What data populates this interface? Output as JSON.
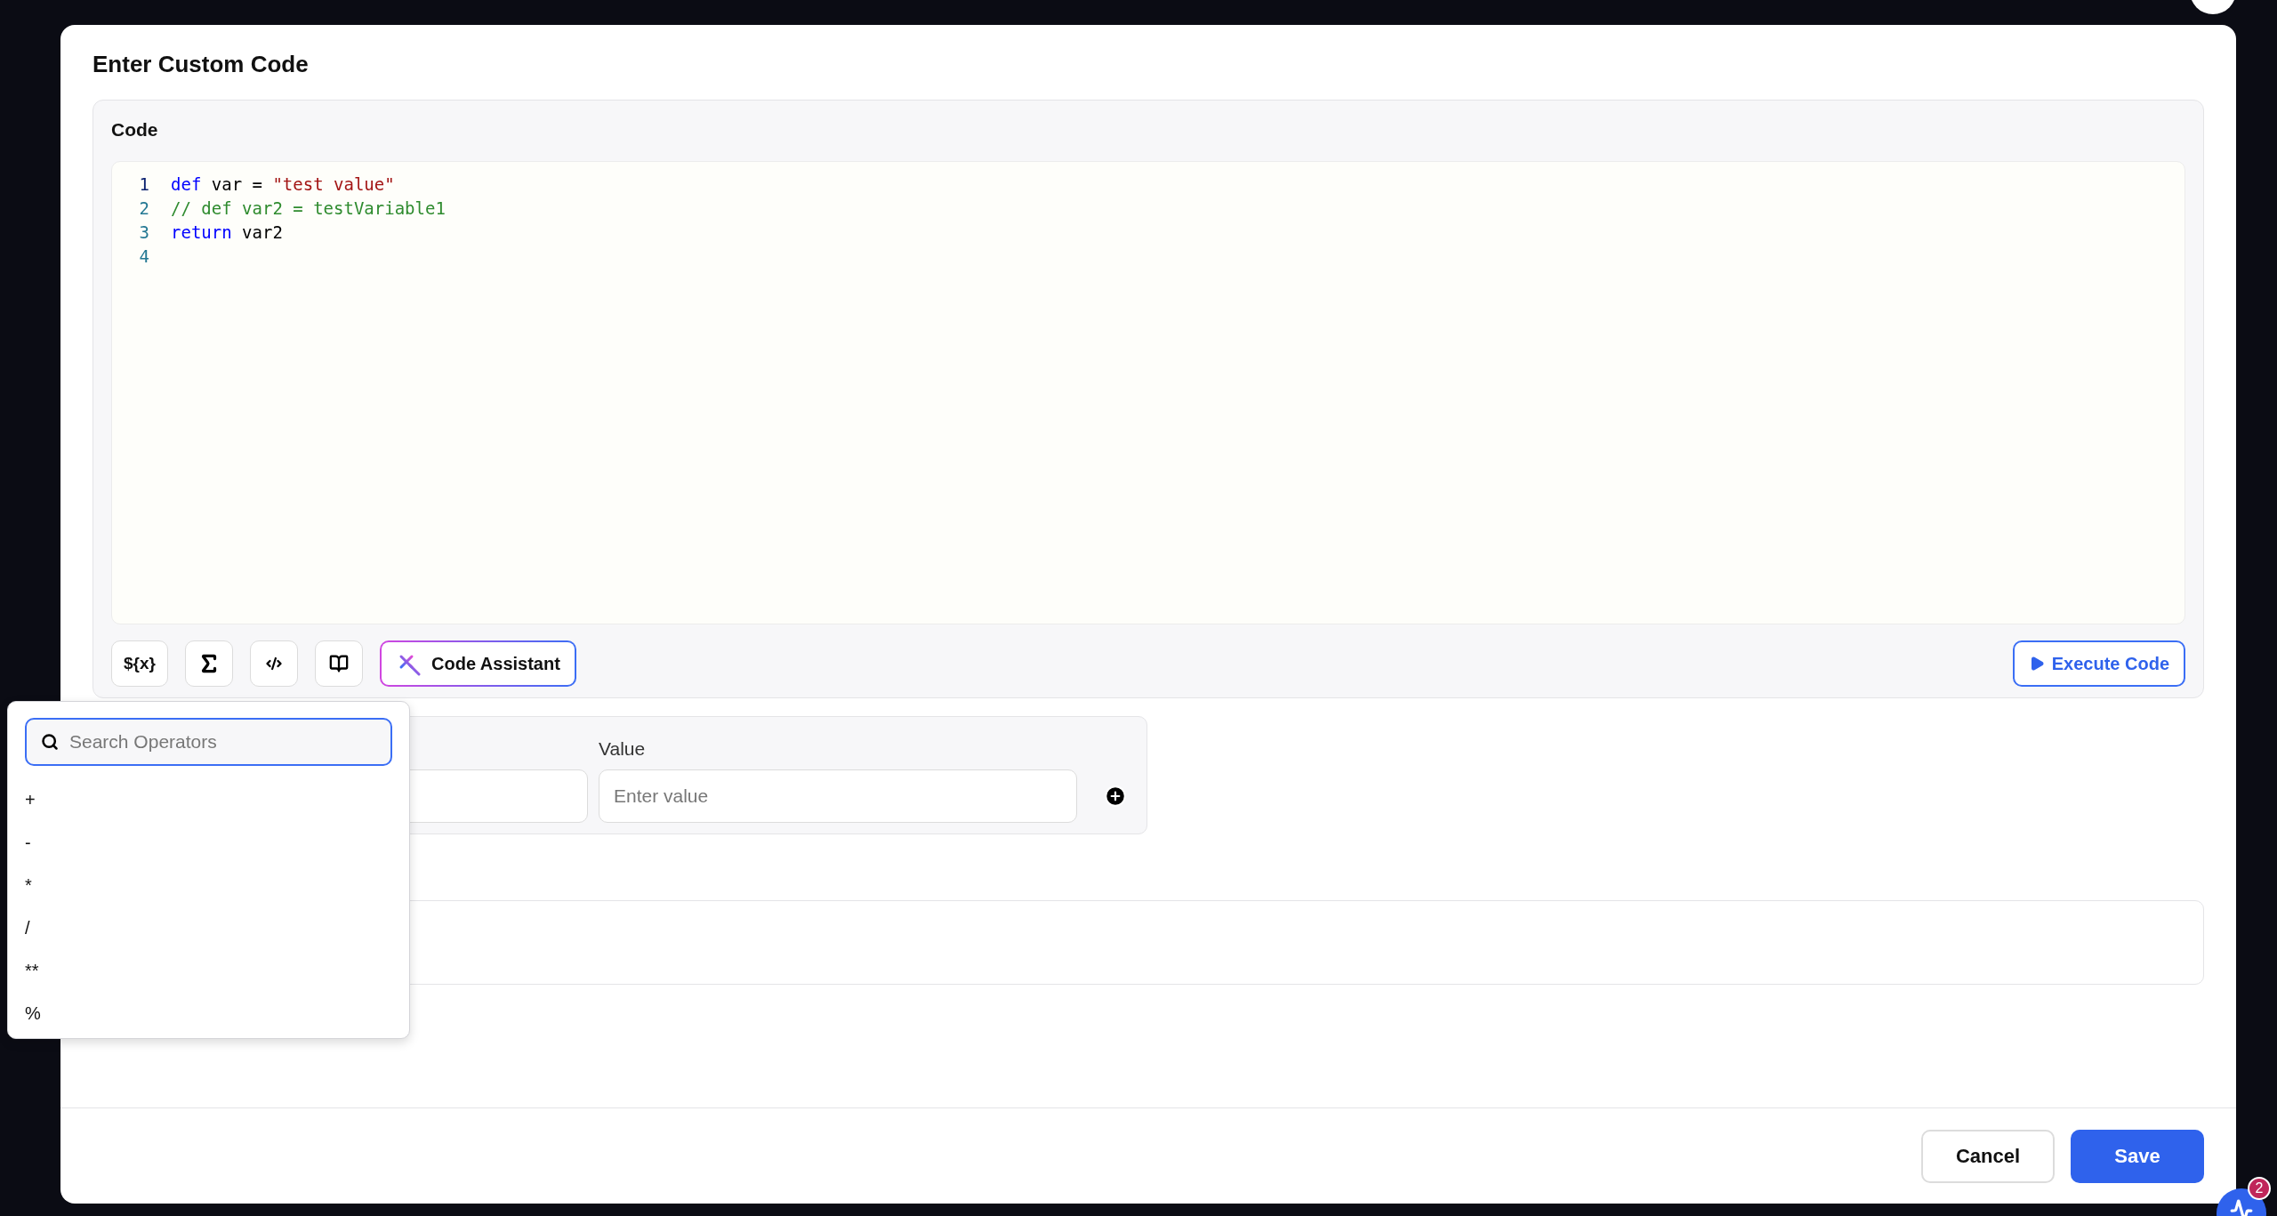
{
  "dialog": {
    "title": "Enter Custom Code"
  },
  "code_panel": {
    "label": "Code",
    "lines": [
      {
        "number": "1",
        "active": true,
        "tokens": [
          {
            "kind": "keyword",
            "text": "def"
          },
          {
            "kind": "plain",
            "text": " var = "
          },
          {
            "kind": "string",
            "text": "\"test value\""
          }
        ]
      },
      {
        "number": "2",
        "active": false,
        "tokens": [
          {
            "kind": "comment",
            "text": "// def var2 = testVariable1"
          }
        ]
      },
      {
        "number": "3",
        "active": false,
        "tokens": [
          {
            "kind": "keyword",
            "text": "return"
          },
          {
            "kind": "plain",
            "text": " var2"
          }
        ]
      },
      {
        "number": "4",
        "active": false
      }
    ],
    "variable_button": "${x}",
    "assistant_button": "Code Assistant",
    "execute_button": "Execute Code"
  },
  "parameters": {
    "value_label": "Value",
    "value_placeholder": "Enter value"
  },
  "operator_menu": {
    "search_placeholder": "Search Operators",
    "items": [
      "+",
      "-",
      "*",
      "/",
      "**",
      "%"
    ]
  },
  "footer": {
    "cancel": "Cancel",
    "save": "Save"
  },
  "notification_badge": "2"
}
